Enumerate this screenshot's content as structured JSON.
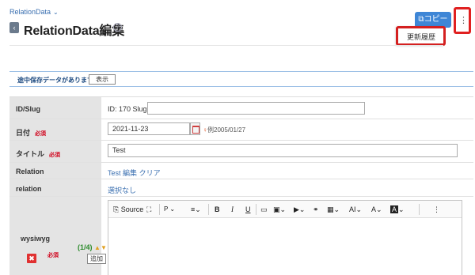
{
  "breadcrumb": {
    "label": "RelationData"
  },
  "header": {
    "title": "RelationData編集",
    "copy_label": "コピー",
    "more_label": "⋮"
  },
  "dropdown": {
    "item": "更新履歴"
  },
  "notice": {
    "text": "途中保存データがあります",
    "button": "表示"
  },
  "form": {
    "id_slug": {
      "label": "ID/Slug",
      "id_text": "ID: 170 Slug:"
    },
    "date": {
      "label": "日付",
      "required": "必須",
      "value": "2021-11-23",
      "hint": "例2005/01/27"
    },
    "title": {
      "label": "タイトル",
      "required": "必須",
      "value": "Test"
    },
    "relation": {
      "label": "Relation",
      "value": "Test",
      "edit": "編集",
      "clear": "クリア"
    },
    "relation2": {
      "label": "relation",
      "value": "選択なし"
    },
    "wysiwyg": {
      "label": "wysiwyg",
      "count": "(1/4)",
      "required": "必須",
      "add": "追加"
    }
  },
  "toolbar": {
    "source": "Source",
    "paragraph": "P",
    "bold": "B",
    "italic": "I",
    "underline": "U",
    "font_size": "AI"
  },
  "colors": {
    "accent": "#3e86d6",
    "highlight_frame": "#e02020",
    "required": "#d0021b"
  }
}
